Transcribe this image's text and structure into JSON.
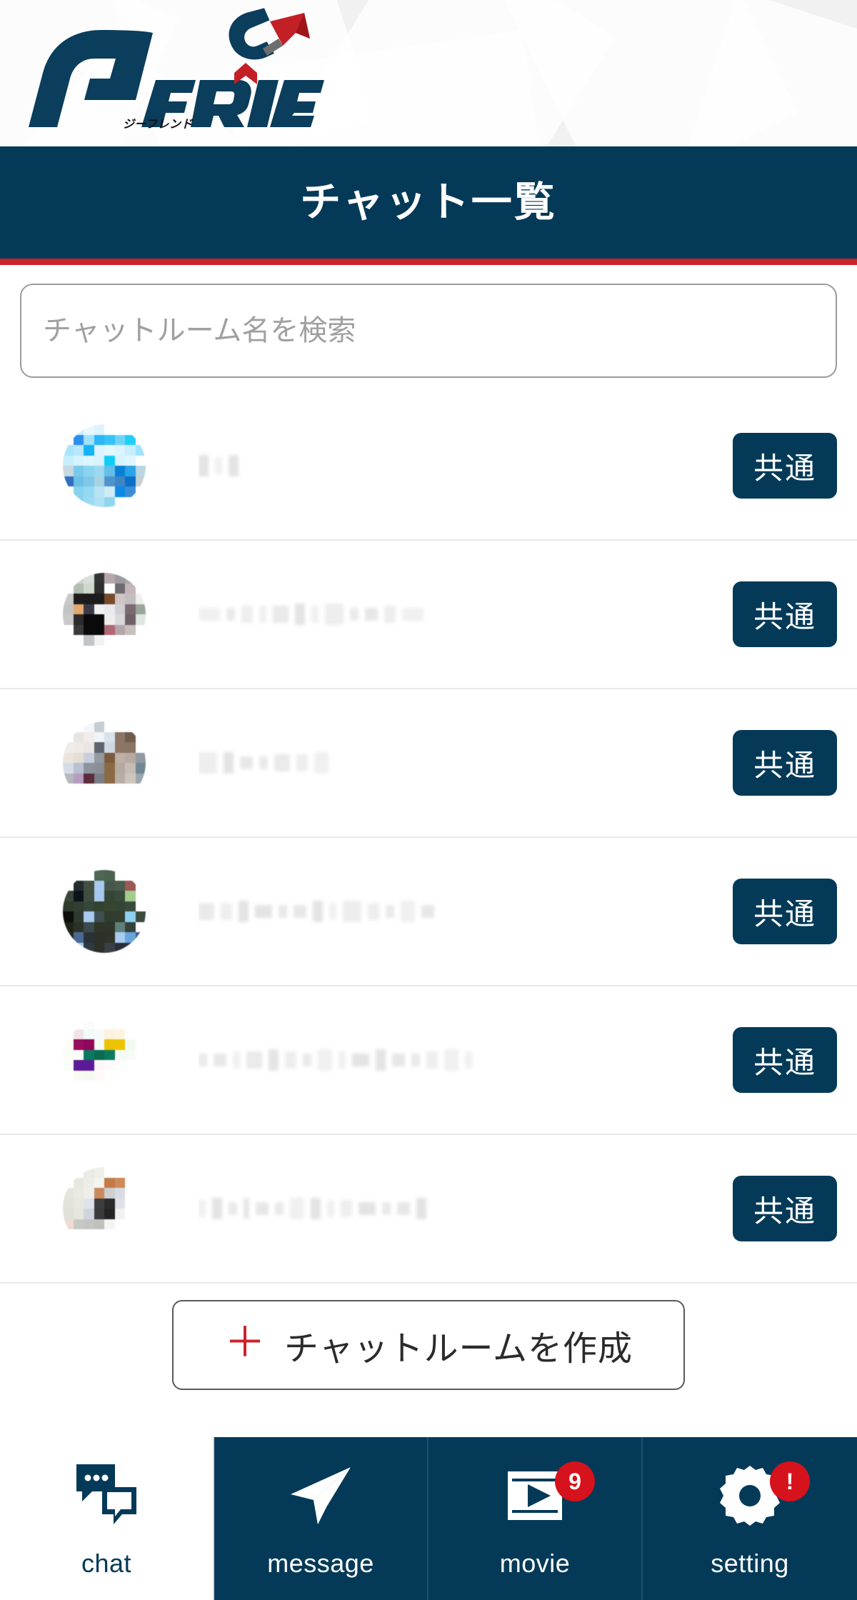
{
  "brand": {
    "logo_text": "GFRiEND",
    "logo_subtitle": "ジーフレンド",
    "navy": "#043a58",
    "red": "#cc2229"
  },
  "header": {
    "title": "チャット一覧"
  },
  "search": {
    "value": "",
    "placeholder": "チャットルーム名を検索"
  },
  "chat_list": {
    "rows": [
      {
        "name": "",
        "name_masked": true,
        "badge": "共通",
        "avatar_colors": [
          "#b9e9fb",
          "#cdeefc",
          "#e8f8fe",
          "#ddf4fd",
          "#ffffff",
          "#ffffff",
          "#ffffff",
          "#ffffff",
          "#ffffff",
          "#2e8ef0",
          "#9fe3fb",
          "#2bb6f5",
          "#34c3f7",
          "#6fd3f8",
          "#21cdf9",
          "#ffffff",
          "#a9e4fb",
          "#b7e8fb",
          "#14b3f6",
          "#dcf4fd",
          "#e3f7fe",
          "#dbf4fd",
          "#c8effc",
          "#9ee2fb",
          "#c6effc",
          "#d5f3fd",
          "#ddf5fd",
          "#d8f3fd",
          "#0fcdfa",
          "#d8f3fd",
          "#e0f6fe",
          "#ffffff",
          "#c6d9e0",
          "#79c9ec",
          "#8cd3ef",
          "#9bd9f1",
          "#63bfe8",
          "#0a7fd6",
          "#2aa4e8",
          "#b9d6e1",
          "#2f6fc0",
          "#6cc0e4",
          "#7ec9e9",
          "#a8d3e2",
          "#4f93cd",
          "#3f84c6",
          "#0b6fc6",
          "#c9cfd2",
          "#ffffff",
          "#86d3ef",
          "#95d8f1",
          "#b6e2f4",
          "#cfecf7",
          "#0b8ae8",
          "#3a8ed6",
          "#ffffff",
          "#ffffff",
          "#86d3ef",
          "#9cdaf2",
          "#b1e1f4",
          "#8fd6f0",
          "#ffffff",
          "#ffffff",
          "#ffffff"
        ]
      },
      {
        "name": "",
        "name_masked": true,
        "badge": "共通",
        "avatar_colors": [
          "#ffffff",
          "#ced6cc",
          "#d6e0d6",
          "#343434",
          "#b8a8ac",
          "#9a9aa0",
          "#a7a7ab",
          "#ffffff",
          "#ffffff",
          "#b4bdb2",
          "#cfd8cd",
          "#2f2f2f",
          "#ffffff",
          "#6c6c70",
          "#c6b6ba",
          "#ffffff",
          "#c9c9c9",
          "#1d1d1d",
          "#1b1b1b",
          "#1c1c1c",
          "#7a4a2c",
          "#cfc6c4",
          "#c2bdbe",
          "#eef0ee",
          "#c4c4c4",
          "#e3a96f",
          "#3a3a46",
          "#f3f1f1",
          "#e9eaf0",
          "#cfcfd3",
          "#7a6a72",
          "#9aa69c",
          "#c9c9c9",
          "#2b2b2b",
          "#0a0a0a",
          "#0a0a0a",
          "#efecec",
          "#d9d8da",
          "#6f5f68",
          "#dfe5df",
          "#ffffff",
          "#3a3a3a",
          "#0a0a0a",
          "#0a0a0a",
          "#b06874",
          "#b3a6aa",
          "#c8bebd",
          "#ffffff",
          "#ffffff",
          "#ffffff",
          "#bfc5c8",
          "#f2f2f2",
          "#ffffff",
          "#ffffff",
          "#ffffff",
          "#ffffff",
          "#ffffff",
          "#ffffff",
          "#ffffff",
          "#ffffff",
          "#ffffff",
          "#ffffff",
          "#ffffff",
          "#ffffff"
        ]
      },
      {
        "name": "",
        "name_masked": true,
        "badge": "共通",
        "avatar_colors": [
          "#ffffff",
          "#ffffff",
          "#f4f6f8",
          "#c7ccd3",
          "#ffffff",
          "#ffffff",
          "#ffffff",
          "#ffffff",
          "#ffffff",
          "#e8e4e1",
          "#efeceb",
          "#eef4f8",
          "#d8e2ea",
          "#8a7466",
          "#6f5a4c",
          "#ffffff",
          "#f0ece8",
          "#eeeae6",
          "#e9e6e4",
          "#5f626a",
          "#cfd9e4",
          "#8d7563",
          "#8a7462",
          "#ffffff",
          "#ebe4de",
          "#e6ddd5",
          "#c8cedb",
          "#949aa2",
          "#7a5a3c",
          "#bdb0a6",
          "#b6aaa2",
          "#8f9aa2",
          "#d6dce6",
          "#b9c0d0",
          "#8e949c",
          "#8a8e96",
          "#8a6a44",
          "#b5aaa0",
          "#c6bcb4",
          "#6f8794",
          "#b4b8bc",
          "#b79cc0",
          "#5c2c3a",
          "#7a7e86",
          "#8c6a46",
          "#b9aea6",
          "#cdc4bc",
          "#9aa6ae",
          "#ffffff",
          "#ffffff",
          "#ffffff",
          "#ffffff",
          "#ffffff",
          "#ffffff",
          "#ffffff",
          "#ffffff",
          "#ffffff",
          "#ffffff",
          "#ffffff",
          "#ffffff",
          "#ffffff",
          "#ffffff",
          "#ffffff",
          "#ffffff"
        ]
      },
      {
        "name": "",
        "name_masked": true,
        "badge": "共通",
        "avatar_colors": [
          "#ffffff",
          "#ffffff",
          "#ffffff",
          "#4e6652",
          "#4a6250",
          "#ffffff",
          "#ffffff",
          "#ffffff",
          "#ffffff",
          "#222c2e",
          "#415042",
          "#a8cbef",
          "#47584a",
          "#4a5c4c",
          "#9a5a56",
          "#ffffff",
          "#3a463a",
          "#0a1418",
          "#3e4e42",
          "#a6c8ec",
          "#354636",
          "#3a4a3c",
          "#a4cc8c",
          "#ffffff",
          "#2e3a2a",
          "#303e34",
          "#36463a",
          "#32422e",
          "#35452f",
          "#344432",
          "#3a4a3a",
          "#ffffff",
          "#0d0d0a",
          "#2e3a30",
          "#a8cbef",
          "#3e4e52",
          "#303c2e",
          "#313d2f",
          "#8ed0ef",
          "#3b4b3d",
          "#1e2418",
          "#2a3226",
          "#3c4a4e",
          "#2e3428",
          "#2f3529",
          "#5f7f7a",
          "#33413a",
          "#ffffff",
          "#242420",
          "#4a6a96",
          "#2a3236",
          "#2c3028",
          "#2e3228",
          "#a8cbef",
          "#6aa4dc",
          "#3a5f8e",
          "#ffffff",
          "#a8cbef",
          "#2e3a3e",
          "#2c3028",
          "#3a3e46",
          "#262e38",
          "#2a323c",
          "#ffffff",
          "#ffffff",
          "#ffffff",
          "#ffffff",
          "#232a3a",
          "#2a3244",
          "#ffffff",
          "#ffffff",
          "#ffffff"
        ]
      },
      {
        "name": "",
        "name_masked": true,
        "badge": "共通",
        "avatar_colors": [
          "#ffffff",
          "#ffffff",
          "#fafcfb",
          "#ffffff",
          "#ffffff",
          "#ffffff",
          "#ffffff",
          "#ffffff",
          "#ffffff",
          "#f2e4e6",
          "#f0fbfa",
          "#f4fbf9",
          "#fdf2de",
          "#fdf4e2",
          "#ffffff",
          "#ffffff",
          "#fafcf6",
          "#960c5e",
          "#92065a",
          "#f5fbf6",
          "#edc200",
          "#eec400",
          "#f2faf2",
          "#ffffff",
          "#fafcf6",
          "#fbfdf9",
          "#0a7a5e",
          "#0a6a54",
          "#0c7a5e",
          "#f4faf4",
          "#f7fbf5",
          "#ffffff",
          "#fbfdf9",
          "#5e1a96",
          "#5e1a96",
          "#fbf7f9",
          "#fdfbfa",
          "#fdfdfb",
          "#ffffff",
          "#ffffff",
          "#ffffff",
          "#f7fbf3",
          "#f4faf2",
          "#fdf9f8",
          "#fefefe",
          "#ffffff",
          "#ffffff",
          "#ffffff",
          "#ffffff",
          "#ffffff",
          "#ffffff",
          "#ffffff",
          "#ffffff",
          "#ffffff",
          "#ffffff",
          "#ffffff",
          "#ffffff",
          "#ffffff",
          "#ffffff",
          "#ffffff",
          "#ffffff",
          "#ffffff",
          "#ffffff",
          "#ffffff"
        ]
      },
      {
        "name": "",
        "name_masked": true,
        "badge": "共通",
        "avatar_colors": [
          "#ffffff",
          "#ffffff",
          "#e8eae4",
          "#eef0ea",
          "#ffffff",
          "#ffffff",
          "#ffffff",
          "#ffffff",
          "#ffffff",
          "#e6e8e0",
          "#eceee6",
          "#f4f4f0",
          "#c27a4a",
          "#cf8a58",
          "#ffffff",
          "#ffffff",
          "#e4e6de",
          "#eaeae2",
          "#eeeeea",
          "#c88a5e",
          "#b8seven",
          "#d8dce4",
          "#ffffff",
          "#ffffff",
          "#e2e4dc",
          "#e8e8e0",
          "#dfe2ea",
          "#3c3c3c",
          "#2a2a2a",
          "#dfe2ea",
          "#ffffff",
          "#ffffff",
          "#e0e2da",
          "#e6e6de",
          "#cfd4de",
          "#3a3a3a",
          "#242424",
          "#f2f2f0",
          "#ffffff",
          "#ffffff",
          "#f0dcd6",
          "#c8c8c4",
          "#c4c4c0",
          "#c0c0bc",
          "#f4f4f2",
          "#ffffff",
          "#ffffff",
          "#ffffff",
          "#ffffff",
          "#ffffff",
          "#ffffff",
          "#ffffff",
          "#ffffff",
          "#ffffff",
          "#ffffff",
          "#ffffff",
          "#ffffff",
          "#ffffff",
          "#ffffff",
          "#ffffff",
          "#ffffff",
          "#ffffff",
          "#ffffff",
          "#ffffff"
        ]
      }
    ]
  },
  "create_button": {
    "plus": "＋",
    "label": "チャットルームを作成"
  },
  "bottom_nav": {
    "items": [
      {
        "label": "chat",
        "icon": "chat-bubbles-icon",
        "active": true,
        "badge": null
      },
      {
        "label": "message",
        "icon": "paper-plane-icon",
        "active": false,
        "badge": null
      },
      {
        "label": "movie",
        "icon": "video-player-icon",
        "active": false,
        "badge": "9"
      },
      {
        "label": "setting",
        "icon": "gear-icon",
        "active": false,
        "badge": "!"
      }
    ]
  }
}
